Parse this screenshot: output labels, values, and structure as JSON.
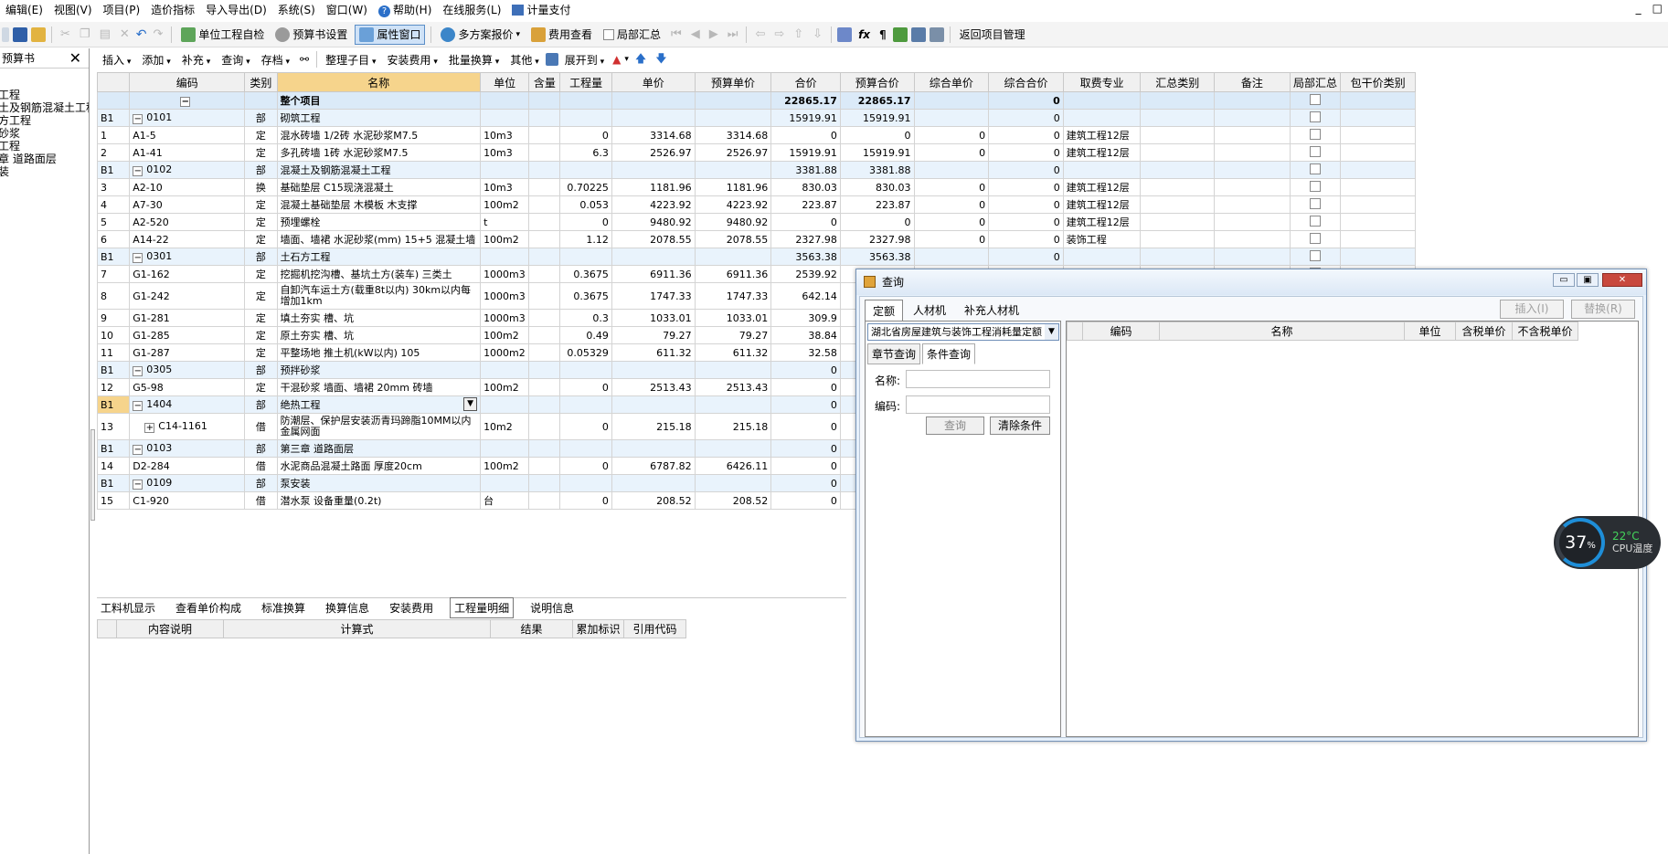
{
  "menubar": {
    "items": [
      "编辑(E)",
      "视图(V)",
      "项目(P)",
      "造价指标",
      "导入导出(D)",
      "系统(S)",
      "窗口(W)",
      "帮助(H)",
      "在线服务(L)",
      "计量支付"
    ],
    "help": "帮助(H)",
    "online": "在线服务(L)",
    "pay": "计量支付",
    "win_controls": [
      "_",
      "□"
    ]
  },
  "toolbar1": {
    "unit_check": "单位工程自检",
    "budget_settings": "预算书设置",
    "property_window": "属性窗口",
    "multi_quote": "多方案报价",
    "fee_view": "费用查看",
    "local_summary": "局部汇总",
    "return_project": "返回项目管理"
  },
  "toolbar2": {
    "items": [
      "插入",
      "添加",
      "补充",
      "查询",
      "存档"
    ],
    "organize": "整理子目",
    "install_fee": "安装费用",
    "batch_convert": "批量换算",
    "other": "其他",
    "expand": "展开到"
  },
  "left_panel": {
    "title": "预算书",
    "tree": [
      "工程",
      "土及钢筋混凝土工程",
      "方工程",
      "砂浆",
      "工程",
      "章 道路面层",
      "装"
    ]
  },
  "grid": {
    "headers": [
      "",
      "编码",
      "类别",
      "名称",
      "单位",
      "含量",
      "工程量",
      "单价",
      "预算单价",
      "合价",
      "预算合价",
      "综合单价",
      "综合合价",
      "取费专业",
      "汇总类别",
      "备注",
      "局部汇总",
      "包干价类别"
    ],
    "total": {
      "name": "整个项目",
      "合价": "22865.17",
      "预算合价": "22865.17",
      "综合合价": "0"
    },
    "rows": [
      {
        "seq": "B1",
        "code": "0101",
        "type": "部",
        "name": "砌筑工程",
        "unit": "",
        "qty": "",
        "price": "",
        "bprice": "",
        "total": "15919.91",
        "btotal": "15919.91",
        "cprice": "",
        "ctotal": "0",
        "fee": "",
        "kind": "sec"
      },
      {
        "seq": "1",
        "code": "A1-5",
        "type": "定",
        "name": "混水砖墙 1/2砖 水泥砂浆M7.5",
        "unit": "10m3",
        "qty": "0",
        "price": "3314.68",
        "bprice": "3314.68",
        "total": "0",
        "btotal": "0",
        "cprice": "0",
        "ctotal": "0",
        "fee": "建筑工程12层",
        "kind": "item"
      },
      {
        "seq": "2",
        "code": "A1-41",
        "type": "定",
        "name": "多孔砖墙 1砖 水泥砂浆M7.5",
        "unit": "10m3",
        "qty": "6.3",
        "price": "2526.97",
        "bprice": "2526.97",
        "total": "15919.91",
        "btotal": "15919.91",
        "cprice": "0",
        "ctotal": "0",
        "fee": "建筑工程12层",
        "kind": "item"
      },
      {
        "seq": "B1",
        "code": "0102",
        "type": "部",
        "name": "混凝土及钢筋混凝土工程",
        "unit": "",
        "qty": "",
        "price": "",
        "bprice": "",
        "total": "3381.88",
        "btotal": "3381.88",
        "cprice": "",
        "ctotal": "0",
        "fee": "",
        "kind": "sec"
      },
      {
        "seq": "3",
        "code": "A2-10",
        "type": "换",
        "name": "基础垫层 C15现浇混凝土",
        "unit": "10m3",
        "qty": "0.70225",
        "price": "1181.96",
        "bprice": "1181.96",
        "total": "830.03",
        "btotal": "830.03",
        "cprice": "0",
        "ctotal": "0",
        "fee": "建筑工程12层",
        "kind": "item"
      },
      {
        "seq": "4",
        "code": "A7-30",
        "type": "定",
        "name": "混凝土基础垫层 木模板 木支撑",
        "unit": "100m2",
        "qty": "0.053",
        "price": "4223.92",
        "bprice": "4223.92",
        "total": "223.87",
        "btotal": "223.87",
        "cprice": "0",
        "ctotal": "0",
        "fee": "建筑工程12层",
        "kind": "item"
      },
      {
        "seq": "5",
        "code": "A2-520",
        "type": "定",
        "name": "预埋螺栓",
        "unit": "t",
        "qty": "0",
        "price": "9480.92",
        "bprice": "9480.92",
        "total": "0",
        "btotal": "0",
        "cprice": "0",
        "ctotal": "0",
        "fee": "建筑工程12层",
        "kind": "item"
      },
      {
        "seq": "6",
        "code": "A14-22",
        "type": "定",
        "name": "墙面、墙裙 水泥砂浆(mm) 15+5 混凝土墙",
        "unit": "100m2",
        "qty": "1.12",
        "price": "2078.55",
        "bprice": "2078.55",
        "total": "2327.98",
        "btotal": "2327.98",
        "cprice": "0",
        "ctotal": "0",
        "fee": "装饰工程",
        "kind": "item"
      },
      {
        "seq": "B1",
        "code": "0301",
        "type": "部",
        "name": "土石方工程",
        "unit": "",
        "qty": "",
        "price": "",
        "bprice": "",
        "total": "3563.38",
        "btotal": "3563.38",
        "cprice": "",
        "ctotal": "0",
        "fee": "",
        "kind": "sec"
      },
      {
        "seq": "7",
        "code": "G1-162",
        "type": "定",
        "name": "挖掘机挖沟槽、基坑土方(装车) 三类土",
        "unit": "1000m3",
        "qty": "0.3675",
        "price": "6911.36",
        "bprice": "6911.36",
        "total": "2539.92",
        "btotal": "",
        "cprice": "",
        "ctotal": "",
        "fee": "",
        "kind": "item"
      },
      {
        "seq": "8",
        "code": "G1-242",
        "type": "定",
        "name": "自卸汽车运土方(载重8t以内) 30km以内每增加1km",
        "unit": "1000m3",
        "qty": "0.3675",
        "price": "1747.33",
        "bprice": "1747.33",
        "total": "642.14",
        "btotal": "",
        "cprice": "",
        "ctotal": "",
        "fee": "",
        "kind": "tall"
      },
      {
        "seq": "9",
        "code": "G1-281",
        "type": "定",
        "name": "填土夯实 槽、坑",
        "unit": "1000m3",
        "qty": "0.3",
        "price": "1033.01",
        "bprice": "1033.01",
        "total": "309.9",
        "btotal": "",
        "cprice": "",
        "ctotal": "",
        "fee": "",
        "kind": "item"
      },
      {
        "seq": "10",
        "code": "G1-285",
        "type": "定",
        "name": "原土夯实 槽、坑",
        "unit": "100m2",
        "qty": "0.49",
        "price": "79.27",
        "bprice": "79.27",
        "total": "38.84",
        "btotal": "",
        "cprice": "",
        "ctotal": "",
        "fee": "",
        "kind": "item"
      },
      {
        "seq": "11",
        "code": "G1-287",
        "type": "定",
        "name": "平整场地 推土机(kW以内) 105",
        "unit": "1000m2",
        "qty": "0.05329",
        "price": "611.32",
        "bprice": "611.32",
        "total": "32.58",
        "btotal": "",
        "cprice": "",
        "ctotal": "",
        "fee": "",
        "kind": "item"
      },
      {
        "seq": "B1",
        "code": "0305",
        "type": "部",
        "name": "预拌砂浆",
        "unit": "",
        "qty": "",
        "price": "",
        "bprice": "",
        "total": "0",
        "btotal": "",
        "cprice": "",
        "ctotal": "",
        "fee": "",
        "kind": "sec"
      },
      {
        "seq": "12",
        "code": "G5-98",
        "type": "定",
        "name": "干混砂浆 墙面、墙裙 20mm 砖墙",
        "unit": "100m2",
        "qty": "0",
        "price": "2513.43",
        "bprice": "2513.43",
        "total": "0",
        "btotal": "",
        "cprice": "",
        "ctotal": "",
        "fee": "",
        "kind": "item"
      },
      {
        "seq": "B1",
        "code": "1404",
        "type": "部",
        "name": "绝热工程",
        "unit": "",
        "qty": "",
        "price": "",
        "bprice": "",
        "total": "0",
        "btotal": "",
        "cprice": "",
        "ctotal": "",
        "fee": "",
        "kind": "sel"
      },
      {
        "seq": "13",
        "code": "C14-1161",
        "type": "借",
        "name": "防潮层、保护层安装沥青玛蹄脂10MM以内金属网面",
        "unit": "10m2",
        "qty": "0",
        "price": "215.18",
        "bprice": "215.18",
        "total": "0",
        "btotal": "",
        "cprice": "",
        "ctotal": "",
        "fee": "",
        "kind": "tall"
      },
      {
        "seq": "B1",
        "code": "0103",
        "type": "部",
        "name": "第三章 道路面层",
        "unit": "",
        "qty": "",
        "price": "",
        "bprice": "",
        "total": "0",
        "btotal": "",
        "cprice": "",
        "ctotal": "",
        "fee": "",
        "kind": "sec"
      },
      {
        "seq": "14",
        "code": "D2-284",
        "type": "借",
        "name": "水泥商品混凝土路面 厚度20cm",
        "unit": "100m2",
        "qty": "0",
        "price": "6787.82",
        "bprice": "6426.11",
        "total": "0",
        "btotal": "",
        "cprice": "",
        "ctotal": "",
        "fee": "",
        "kind": "item"
      },
      {
        "seq": "B1",
        "code": "0109",
        "type": "部",
        "name": "泵安装",
        "unit": "",
        "qty": "",
        "price": "",
        "bprice": "",
        "total": "0",
        "btotal": "",
        "cprice": "",
        "ctotal": "",
        "fee": "",
        "kind": "sec"
      },
      {
        "seq": "15",
        "code": "C1-920",
        "type": "借",
        "name": "潜水泵 设备重量(0.2t)",
        "unit": "台",
        "qty": "0",
        "price": "208.52",
        "bprice": "208.52",
        "total": "0",
        "btotal": "",
        "cprice": "",
        "ctotal": "",
        "fee": "",
        "kind": "item"
      }
    ]
  },
  "bottom_tabs": [
    "工料机显示",
    "查看单价构成",
    "标准换算",
    "换算信息",
    "安装费用",
    "工程量明细",
    "说明信息"
  ],
  "detail_headers": [
    "内容说明",
    "计算式",
    "结果",
    "累加标识",
    "引用代码"
  ],
  "query_dialog": {
    "title": "查询",
    "tabs": [
      "定额",
      "人材机",
      "补充人材机"
    ],
    "insert": "插入(I)",
    "replace": "替换(R)",
    "library": "湖北省房屋建筑与装饰工程消耗量定额",
    "subtabs": [
      "章节查询",
      "条件查询"
    ],
    "name_label": "名称:",
    "code_label": "编码:",
    "query_btn": "查询",
    "clear_btn": "清除条件",
    "result_headers": [
      "编码",
      "名称",
      "单位",
      "含税单价",
      "不含税单价"
    ]
  },
  "cpu_widget": {
    "percent": "37",
    "pct_sign": "%",
    "temp": "22°C",
    "label": "CPU温度"
  },
  "colors": {
    "header_name": "#f6d48c",
    "section": "#e9f3fc",
    "total": "#dbeaf8",
    "accent": "#1e8ed8"
  }
}
